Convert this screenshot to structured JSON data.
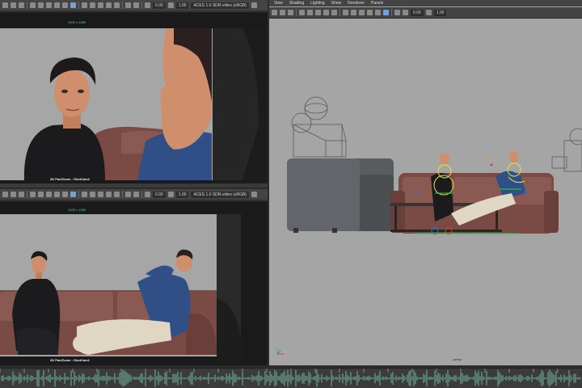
{
  "left_top_viewport": {
    "resolution_label": "1920 x 1080",
    "zoom_value": "0.00",
    "scale_value": "1.00",
    "colorspace": "ACES 1.0 SDR-video (sRGB)",
    "camera_label": "2D Pan/Zoom : ShotCam2"
  },
  "left_bottom_viewport": {
    "resolution_label": "1920 x 1080",
    "zoom_value": "0.00",
    "scale_value": "1.00",
    "colorspace": "ACES 1.0 SDR-video (sRGB)",
    "camera_label": "2D Pan/Zoom : ShotCam1"
  },
  "right_viewport": {
    "menu": [
      "View",
      "Shading",
      "Lighting",
      "Show",
      "Renderer",
      "Panels"
    ],
    "zoom_value": "0.00",
    "scale_value": "1.00",
    "camera_label": "persp"
  },
  "colors": {
    "sofa": "#7a4b45",
    "sweater_black": "#1b1b1d",
    "sweater_blue": "#2f4f86",
    "skin": "#d08d6a",
    "viewport_gray": "#a5a5a5",
    "chair_gray": "#5a5d60"
  }
}
